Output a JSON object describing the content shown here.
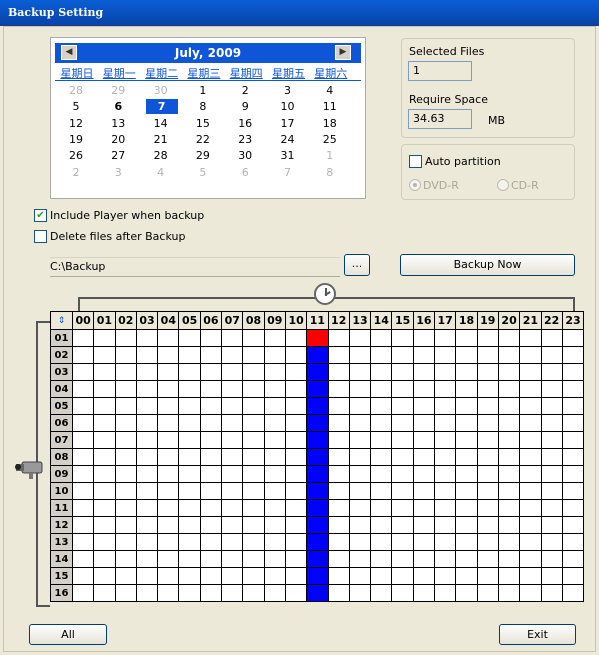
{
  "window": {
    "title": "Backup Setting"
  },
  "calendar": {
    "prev_label": "◀",
    "next_label": "▶",
    "month_title": "July, 2009",
    "weekdays": [
      "星期日",
      "星期一",
      "星期二",
      "星期三",
      "星期四",
      "星期五",
      "星期六"
    ],
    "weeks": [
      [
        "28",
        "29",
        "30",
        "1",
        "2",
        "3",
        "4"
      ],
      [
        "5",
        "6",
        "7",
        "8",
        "9",
        "10",
        "11"
      ],
      [
        "12",
        "13",
        "14",
        "15",
        "16",
        "17",
        "18"
      ],
      [
        "19",
        "20",
        "21",
        "22",
        "23",
        "24",
        "25"
      ],
      [
        "26",
        "27",
        "28",
        "29",
        "30",
        "31",
        "1"
      ],
      [
        "2",
        "3",
        "4",
        "5",
        "6",
        "7",
        "8"
      ]
    ],
    "selected_day": "7"
  },
  "files": {
    "selected_label": "Selected Files",
    "selected_value": "1",
    "require_label": "Require Space",
    "require_value": "34.63",
    "require_unit": "MB"
  },
  "partition": {
    "auto_label": "Auto partition",
    "dvd_label": "DVD-R",
    "cd_label": "CD-R"
  },
  "options": {
    "include_player_label": "Include Player when backup",
    "include_player_checked": true,
    "delete_files_label": "Delete files after Backup",
    "delete_files_checked": false
  },
  "path": {
    "value": "C:\\Backup",
    "browse_label": "..."
  },
  "actions": {
    "backup_now_label": "Backup Now",
    "all_label": "All",
    "exit_label": "Exit"
  },
  "grid": {
    "corner_label": "⇕",
    "hours": [
      "00",
      "01",
      "02",
      "03",
      "04",
      "05",
      "06",
      "07",
      "08",
      "09",
      "10",
      "11",
      "12",
      "13",
      "14",
      "15",
      "16",
      "17",
      "18",
      "19",
      "20",
      "21",
      "22",
      "23"
    ],
    "channels": [
      "01",
      "02",
      "03",
      "04",
      "05",
      "06",
      "07",
      "08",
      "09",
      "10",
      "11",
      "12",
      "13",
      "14",
      "15",
      "16"
    ],
    "selected_hour": "11",
    "highlight_channel": "01",
    "colors": {
      "selected": "#0000ff",
      "highlight": "#ff0000"
    }
  }
}
